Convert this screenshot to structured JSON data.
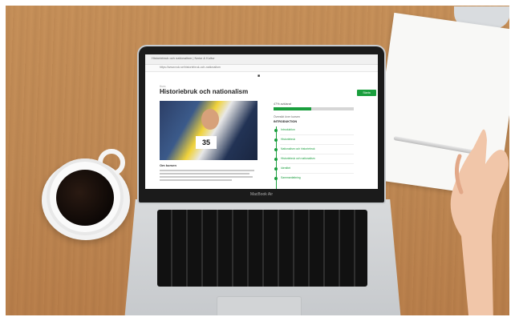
{
  "page": {
    "tab_title": "Historiebruk och nationalism | Natur & Kultur",
    "url": "https://www.nok.se/historiebruk-och-nationalism",
    "breadcrumb": "Kurs",
    "title": "Historiebruk och nationalism",
    "start_button": "Starta",
    "hero_number": "35",
    "article_heading": "Om kursen"
  },
  "sidebar": {
    "progress_label": "47% avklarat",
    "progress_value": 0.47,
    "section_label": "Översikt över kursen",
    "intro_label": "INTRODUKTION",
    "steps": [
      "Introduktion",
      "Historiebruk",
      "Nationalism och historiebruk",
      "Historiebruk och nationalism",
      "Identitet",
      "Sammanfattning"
    ]
  },
  "laptop": {
    "model_label": "MacBook Air"
  },
  "colors": {
    "accent": "#1a9e3d",
    "table_wood": "#c08a55"
  }
}
